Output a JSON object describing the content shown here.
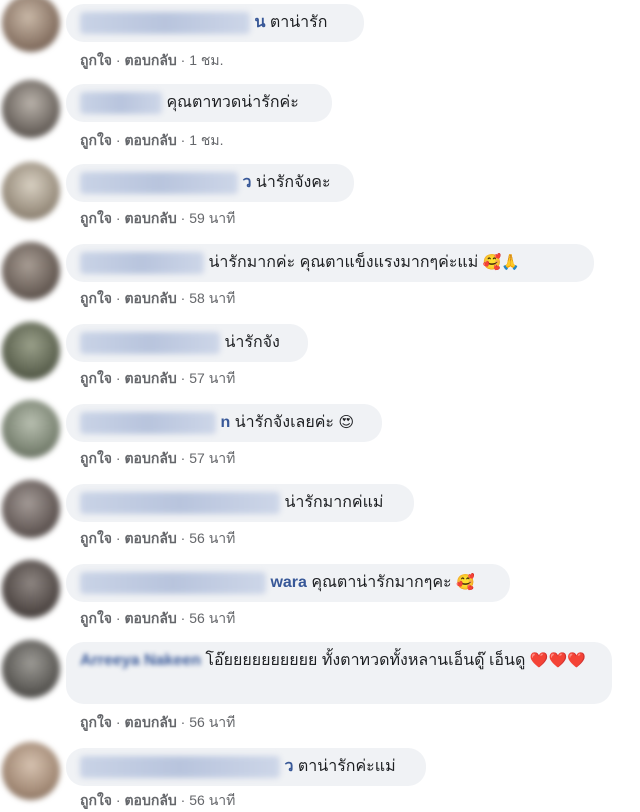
{
  "comments": [
    {
      "author": "",
      "author_suffix": "น",
      "text": "ตาน่ารัก",
      "like": "ถูกใจ",
      "reply": "ตอบกลับ",
      "time": "1 ชม."
    },
    {
      "author": "",
      "author_suffix": "",
      "text": "คุณตาทวดน่ารักค่ะ",
      "like": "ถูกใจ",
      "reply": "ตอบกลับ",
      "time": "1 ชม."
    },
    {
      "author": "",
      "author_suffix": "ว",
      "text": "น่ารักจังคะ",
      "like": "ถูกใจ",
      "reply": "ตอบกลับ",
      "time": "59 นาที"
    },
    {
      "author": "",
      "author_suffix": "",
      "text": "น่ารักมากค่ะ คุณตาแข็งแรงมากๆค่ะแม่",
      "emoji": "🥰🙏",
      "like": "ถูกใจ",
      "reply": "ตอบกลับ",
      "time": "58 นาที"
    },
    {
      "author": "",
      "author_suffix": "",
      "text": "น่ารักจัง",
      "like": "ถูกใจ",
      "reply": "ตอบกลับ",
      "time": "57 นาที"
    },
    {
      "author": "",
      "author_suffix": "n",
      "text": "น่ารักจังเลยค่ะ",
      "emoji": "😍",
      "like": "ถูกใจ",
      "reply": "ตอบกลับ",
      "time": "57 นาที"
    },
    {
      "author": "",
      "author_suffix": "",
      "text": "น่ารักมากค่แม่",
      "like": "ถูกใจ",
      "reply": "ตอบกลับ",
      "time": "56 นาที"
    },
    {
      "author": "",
      "author_suffix": "wara",
      "text": "คุณตาน่ารักมากๆคะ",
      "emoji": "🥰",
      "like": "ถูกใจ",
      "reply": "ตอบกลับ",
      "time": "56 นาที"
    },
    {
      "author": "Arreeya Nakeen",
      "author_suffix": "",
      "text": "โอ๊ยยยยยยยยยย ทั้งตาทวดทั้งหลานเอ็นดู๊ เอ็นดู",
      "emoji": "❤️❤️❤️",
      "like": "ถูกใจ",
      "reply": "ตอบกลับ",
      "time": "56 นาที"
    },
    {
      "author": "",
      "author_suffix": "ว",
      "text": "ตาน่ารักค่ะแม่",
      "like": "ถูกใจ",
      "reply": "ตอบกลับ",
      "time": "56 นาที"
    }
  ],
  "separator": " · ",
  "colors": {
    "bubble": "#f0f2f5",
    "author": "#385898",
    "meta": "#65676b"
  }
}
